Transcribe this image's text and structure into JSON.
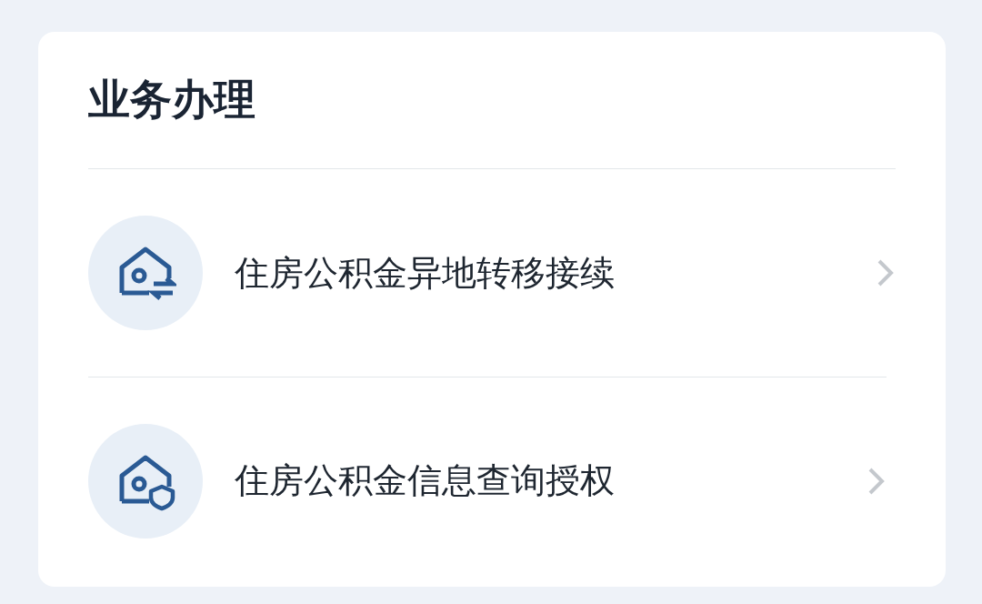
{
  "section": {
    "title": "业务办理"
  },
  "items": [
    {
      "kind": "transfer",
      "label": "住房公积金异地转移接续"
    },
    {
      "kind": "shield",
      "label": "住房公积金信息查询授权"
    }
  ]
}
